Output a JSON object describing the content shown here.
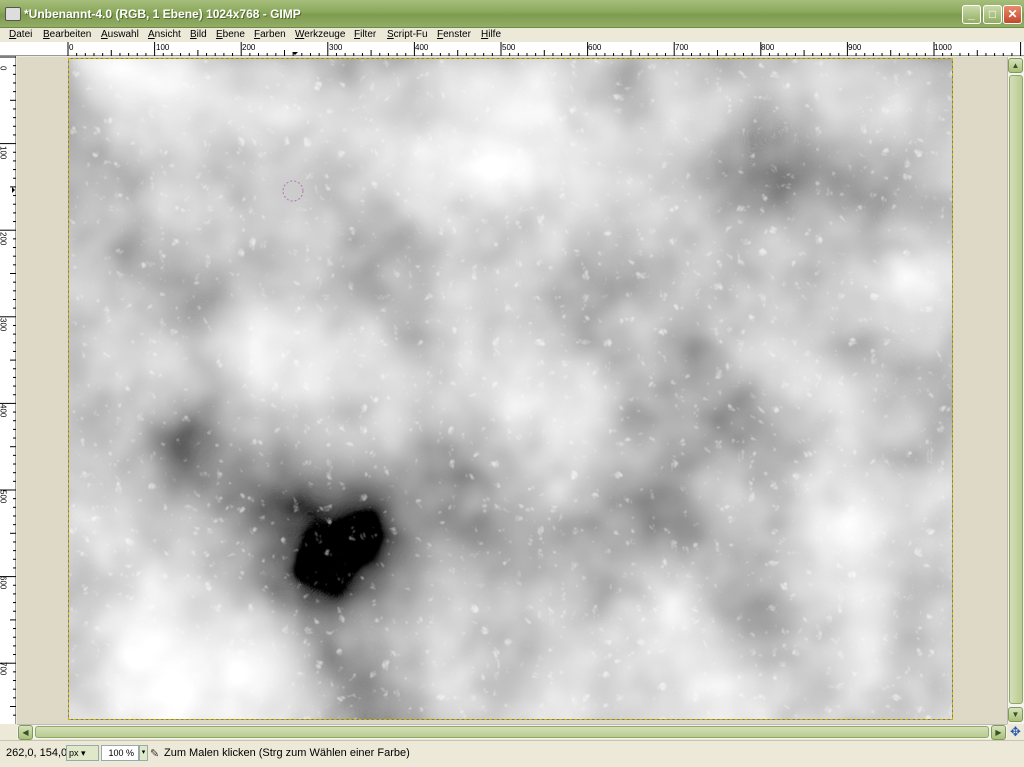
{
  "window": {
    "title": "*Unbenannt-4.0 (RGB, 1 Ebene) 1024x768 - GIMP",
    "minimize": "_",
    "maximize": "□",
    "close": "✕"
  },
  "menu": [
    "Datei",
    "Bearbeiten",
    "Auswahl",
    "Ansicht",
    "Bild",
    "Ebene",
    "Farben",
    "Werkzeuge",
    "Filter",
    "Script-Fu",
    "Fenster",
    "Hilfe"
  ],
  "ruler_h": [
    "0",
    "100",
    "200",
    "300",
    "400",
    "500",
    "600",
    "700",
    "800",
    "900",
    "1000"
  ],
  "ruler_v": [
    "0",
    "100",
    "200",
    "300",
    "400",
    "500",
    "600",
    "700"
  ],
  "status": {
    "coords": "262,0, 154,0",
    "unit": "px",
    "zoom": "100 %",
    "message": "Zum Malen klicken (Strg zum Wählen einer Farbe)"
  },
  "icons": [
    "app-icon",
    "quick-mask-icon",
    "brush-icon",
    "navigate-icon"
  ],
  "colors": {
    "titlebar": "#8aa85a",
    "selection_border": "#c8b400",
    "close_button": "#c4482b"
  }
}
